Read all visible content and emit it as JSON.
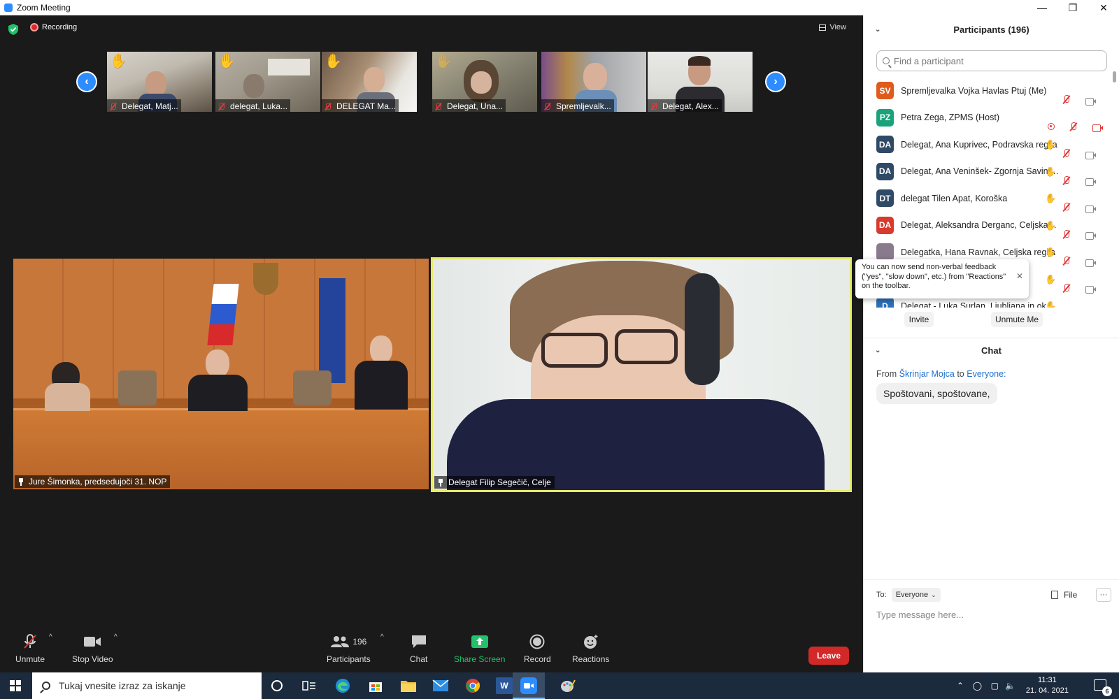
{
  "window": {
    "title": "Zoom Meeting",
    "minimize": "—",
    "restore": "❐",
    "close": "✕"
  },
  "meeting": {
    "recording_label": "Recording",
    "view_label": "View",
    "thumbnails": [
      {
        "name": "Delegat, Matj...",
        "hand": "✋"
      },
      {
        "name": "delegat, Luka...",
        "hand": "✋"
      },
      {
        "name": "DELEGAT Ma...",
        "hand": "✋"
      },
      {
        "name": "Delegat, Una...",
        "hand": "✋"
      },
      {
        "name": "Spremljevalk...",
        "hand": ""
      },
      {
        "name": "Delegat, Alex...",
        "hand": ""
      }
    ],
    "prev_arrow": "‹",
    "next_arrow": "›",
    "videos": [
      {
        "name": "Jure Šimonka, predsedujoči 31. NOP"
      },
      {
        "name": "Delegat Filip Segečič, Celje"
      }
    ]
  },
  "toolbar": {
    "unmute": "Unmute",
    "stop_video": "Stop Video",
    "participants": "Participants",
    "participants_count": "196",
    "chat": "Chat",
    "share_screen": "Share Screen",
    "record": "Record",
    "reactions": "Reactions",
    "leave": "Leave",
    "caret": "^"
  },
  "participants_panel": {
    "title": "Participants (196)",
    "search_placeholder": "Find a participant",
    "list": [
      {
        "initials": "SV",
        "color": "#e05a1c",
        "name": "Spremljevalka Vojka Havlas Ptuj (Me)",
        "hand": "",
        "rec": false,
        "cam_off": false
      },
      {
        "initials": "PZ",
        "color": "#1aa37a",
        "name": "Petra Zega, ZPMS (Host)",
        "hand": "",
        "rec": true,
        "cam_off": true
      },
      {
        "initials": "DA",
        "color": "#2f4a66",
        "name": "Delegat, Ana Kuprivec, Podravska regija",
        "hand": "✋",
        "rec": false,
        "cam_off": false
      },
      {
        "initials": "DA",
        "color": "#2f4a66",
        "name": "Delegat, Ana Veninšek- Zgornja Savinjs...",
        "hand": "✋",
        "rec": false,
        "cam_off": false
      },
      {
        "initials": "DT",
        "color": "#2f4a66",
        "name": "delegat Tilen Apat, Koroška",
        "hand": "✋",
        "rec": false,
        "cam_off": false
      },
      {
        "initials": "DA",
        "color": "#d83a2e",
        "name": "Delegat, Aleksandra Derganc, Celjska r...",
        "hand": "✋",
        "rec": false,
        "cam_off": false
      },
      {
        "initials": "",
        "color": "#8a7a8e",
        "name": "Delegatka, Hana Ravnak, Celjska regija",
        "hand": "✋",
        "rec": false,
        "cam_off": false
      },
      {
        "initials": "",
        "color": "#2f4a66",
        "name": "",
        "hand": "✋",
        "rec": false,
        "cam_off": false
      },
      {
        "initials": "D",
        "color": "#2f6fb6",
        "name": "Delegat - Luka Surlan, Ljubljana in okol...",
        "hand": "✋",
        "rec": false,
        "cam_off": false
      }
    ],
    "tooltip": "You can now send non-verbal feedback (\"yes\", \"slow down\", etc.) from \"Reactions\" on the toolbar.",
    "tooltip_close": "✕",
    "invite": "Invite",
    "unmute_me": "Unmute Me"
  },
  "chat_panel": {
    "title": "Chat",
    "from_label": "From",
    "sender": "Škrinjar Mojca",
    "to_label": "to",
    "recipient": "Everyone:",
    "message": "Spoštovani, spoštovane,",
    "to_prefix": "To:",
    "to_value": "Everyone",
    "file_label": "File",
    "more_label": "···",
    "input_placeholder": "Type message here..."
  },
  "taskbar": {
    "search_placeholder": "Tukaj vnesite izraz za iskanje",
    "time": "11:31",
    "date": "21. 04. 2021",
    "notification_count": "6"
  }
}
